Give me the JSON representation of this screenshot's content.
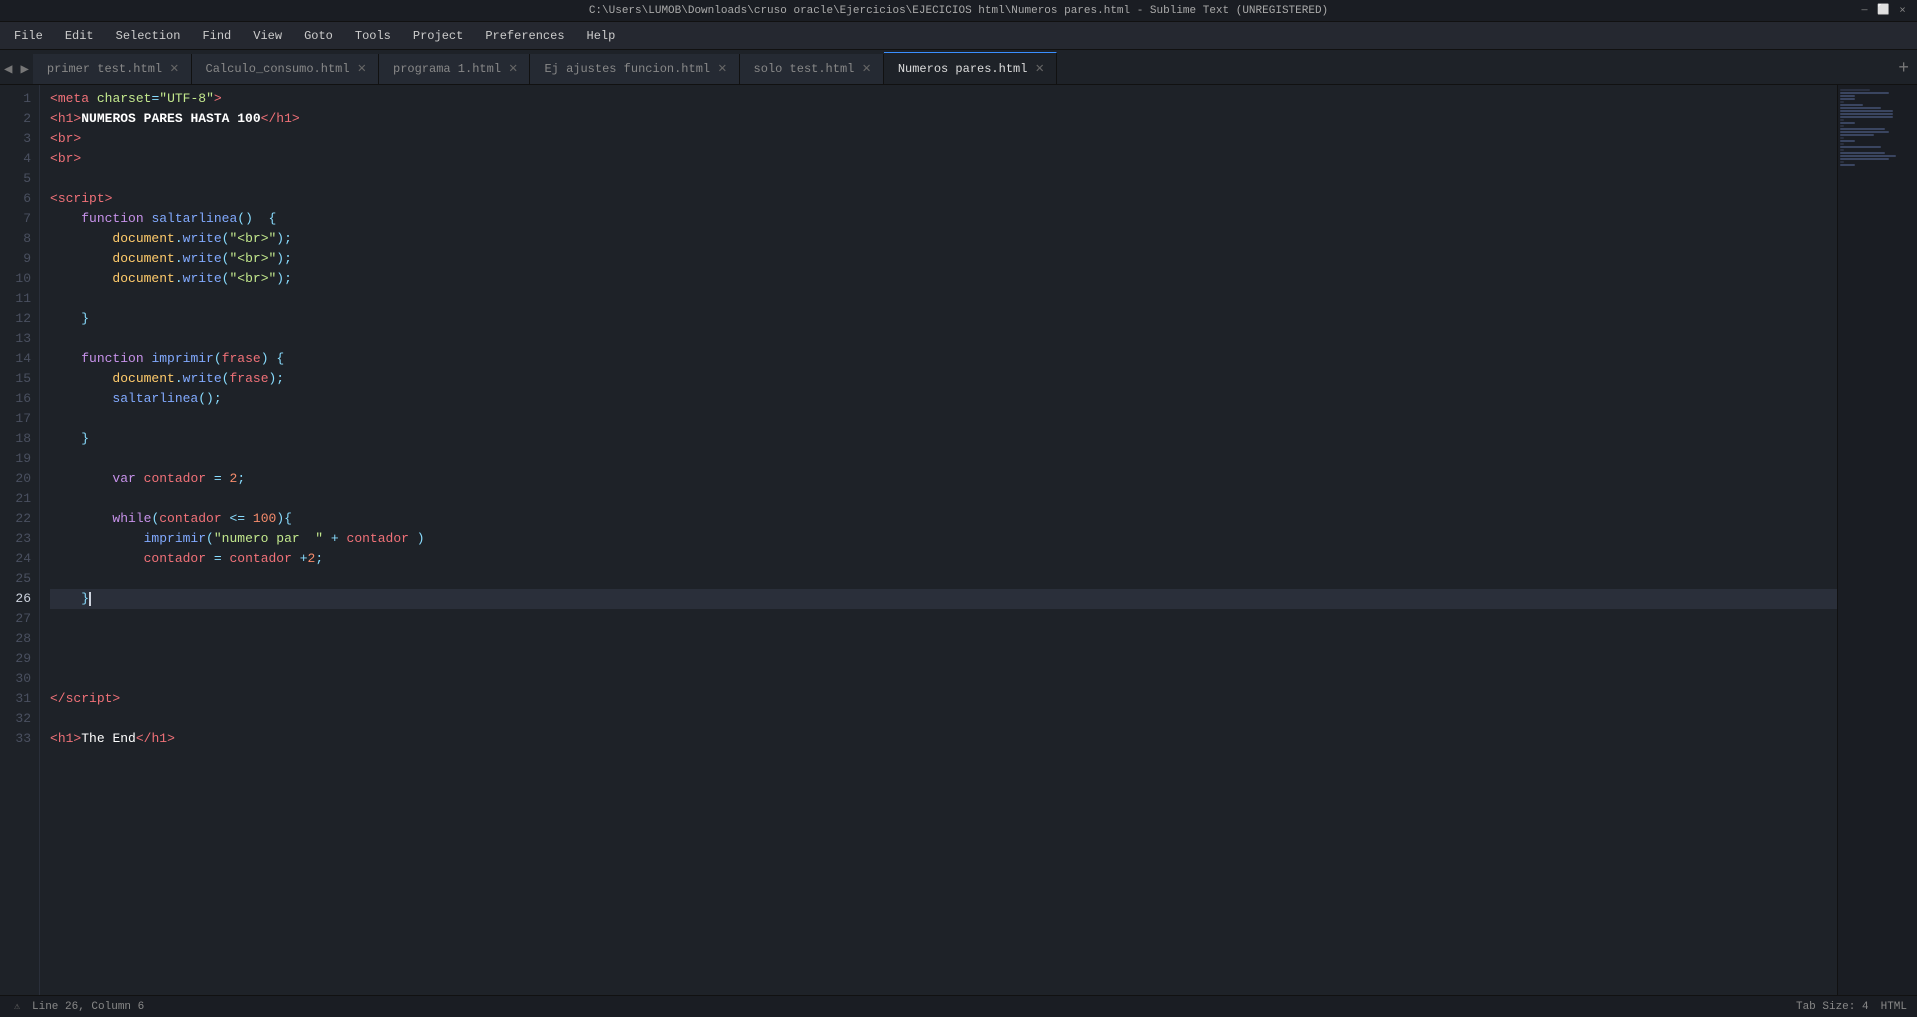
{
  "titleBar": {
    "text": "C:\\Users\\LUMOB\\Downloads\\cruso oracle\\Ejercicios\\EJECICIOS html\\Numeros pares.html - Sublime Text (UNREGISTERED)"
  },
  "menuBar": {
    "items": [
      "File",
      "Edit",
      "Selection",
      "Find",
      "View",
      "Goto",
      "Tools",
      "Project",
      "Preferences",
      "Help"
    ]
  },
  "tabs": [
    {
      "label": "primer test.html",
      "active": false,
      "closable": true
    },
    {
      "label": "Calculo_consumo.html",
      "active": false,
      "closable": true
    },
    {
      "label": "programa 1.html",
      "active": false,
      "closable": true
    },
    {
      "label": "Ej ajustes funcion.html",
      "active": false,
      "closable": true
    },
    {
      "label": "solo test.html",
      "active": false,
      "closable": true
    },
    {
      "label": "Numeros pares.html",
      "active": true,
      "closable": true
    }
  ],
  "statusBar": {
    "lineCol": "Line 26, Column 6",
    "tabSize": "Tab Size: 4",
    "language": "HTML",
    "errorIcon": "⚠",
    "errorText": ""
  },
  "lines": [
    {
      "num": 1,
      "content": "meta_utf8"
    },
    {
      "num": 2,
      "content": "h1_numeros"
    },
    {
      "num": 3,
      "content": "br_tag"
    },
    {
      "num": 4,
      "content": "br_tag2"
    },
    {
      "num": 5,
      "content": "empty"
    },
    {
      "num": 6,
      "content": "script_open"
    },
    {
      "num": 7,
      "content": "fn_saltarlinea"
    },
    {
      "num": 8,
      "content": "doc_write_br1"
    },
    {
      "num": 9,
      "content": "doc_write_br2"
    },
    {
      "num": 10,
      "content": "doc_write_br3"
    },
    {
      "num": 11,
      "content": "empty"
    },
    {
      "num": 12,
      "content": "close_brace1"
    },
    {
      "num": 13,
      "content": "empty"
    },
    {
      "num": 14,
      "content": "fn_imprimir"
    },
    {
      "num": 15,
      "content": "doc_write_frase"
    },
    {
      "num": 16,
      "content": "saltarlinea_call"
    },
    {
      "num": 17,
      "content": "empty"
    },
    {
      "num": 18,
      "content": "close_brace2"
    },
    {
      "num": 19,
      "content": "empty"
    },
    {
      "num": 20,
      "content": "var_contador"
    },
    {
      "num": 21,
      "content": "empty"
    },
    {
      "num": 22,
      "content": "while_start"
    },
    {
      "num": 23,
      "content": "imprimir_call"
    },
    {
      "num": 24,
      "content": "contador_assign"
    },
    {
      "num": 25,
      "content": "empty"
    },
    {
      "num": 26,
      "content": "close_brace3_cursor"
    },
    {
      "num": 27,
      "content": "empty"
    },
    {
      "num": 28,
      "content": "empty"
    },
    {
      "num": 29,
      "content": "empty"
    },
    {
      "num": 30,
      "content": "empty"
    },
    {
      "num": 31,
      "content": "script_close"
    },
    {
      "num": 32,
      "content": "empty"
    },
    {
      "num": 33,
      "content": "h1_end"
    }
  ]
}
